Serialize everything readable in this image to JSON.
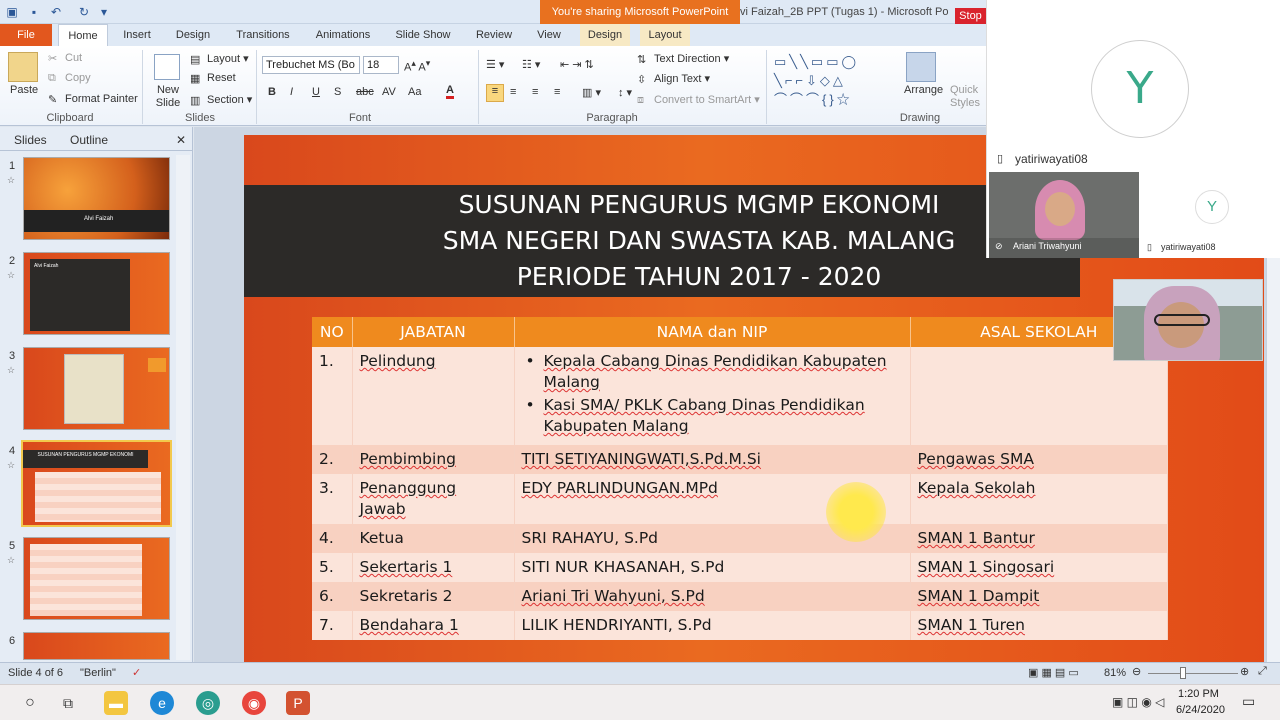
{
  "titlebar": {
    "share_banner": "You're sharing Microsoft PowerPoint",
    "window_title": "vi Faizah_2B PPT (Tugas 1) - Microsoft Po",
    "stop_label": "Stop"
  },
  "tabs": [
    "File",
    "Home",
    "Insert",
    "Design",
    "Transitions",
    "Animations",
    "Slide Show",
    "Review",
    "View",
    "Design",
    "Layout"
  ],
  "ribbon": {
    "clipboard": {
      "label": "Clipboard",
      "paste": "Paste",
      "cut": "Cut",
      "copy": "Copy",
      "format_painter": "Format Painter"
    },
    "slides": {
      "label": "Slides",
      "new_slide": "New Slide",
      "layout": "Layout",
      "reset": "Reset",
      "section": "Section"
    },
    "font": {
      "label": "Font",
      "family": "Trebuchet MS (Bo",
      "size": "18"
    },
    "paragraph": {
      "label": "Paragraph",
      "text_direction": "Text Direction",
      "align_text": "Align Text",
      "smartart": "Convert to SmartArt"
    },
    "drawing": {
      "label": "Drawing",
      "arrange": "Arrange",
      "quick_styles": "Quick Styles"
    }
  },
  "left_panel": {
    "tabs": [
      "Slides",
      "Outline"
    ],
    "thumbnails": [
      {
        "num": "1",
        "caption": "Alvi Faizah"
      },
      {
        "num": "2",
        "caption": "Alvi Faizah"
      },
      {
        "num": "3",
        "caption": ""
      },
      {
        "num": "4",
        "caption": "SUSUNAN PENGURUS MGMP EKONOMI"
      },
      {
        "num": "5",
        "caption": ""
      },
      {
        "num": "6",
        "caption": ""
      }
    ]
  },
  "slide": {
    "title_lines": [
      "SUSUNAN PENGURUS MGMP EKONOMI",
      "SMA NEGERI DAN SWASTA KAB. MALANG",
      "PERIODE TAHUN 2017 - 2020"
    ],
    "table": {
      "headers": [
        "NO",
        "JABATAN",
        "NAMA dan NIP",
        "ASAL SEKOLAH"
      ],
      "rows": [
        {
          "no": "1.",
          "jabatan": "Pelindung",
          "nama": "",
          "nama_list": [
            "Kepala Cabang Dinas Pendidikan Kabupaten Malang",
            "Kasi SMA/ PKLK Cabang Dinas Pendidikan Kabupaten Malang"
          ],
          "asal": ""
        },
        {
          "no": "2.",
          "jabatan": "Pembimbing",
          "nama": "TITI SETIYANINGWATI,S.Pd.M.Si",
          "asal": "Pengawas SMA"
        },
        {
          "no": "3.",
          "jabatan": "Penanggung Jawab",
          "nama": "EDY PARLINDUNGAN.MPd",
          "asal": "Kepala Sekolah"
        },
        {
          "no": "4.",
          "jabatan": "Ketua",
          "nama": "SRI RAHAYU, S.Pd",
          "asal": "SMAN 1 Bantur"
        },
        {
          "no": "5.",
          "jabatan": "Sekertaris 1",
          "nama": "SITI NUR KHASANAH, S.Pd",
          "asal": "SMAN 1 Singosari"
        },
        {
          "no": "6.",
          "jabatan": "Sekretaris 2",
          "nama": "Ariani Tri Wahyuni, S.Pd",
          "asal": "SMAN 1 Dampit"
        },
        {
          "no": "7.",
          "jabatan": "Bendahara 1",
          "nama": "LILIK HENDRIYANTI, S.Pd",
          "asal": "SMAN 1 Turen"
        }
      ]
    }
  },
  "statusbar": {
    "slide_info": "Slide 4 of 6",
    "theme": "\"Berlin\"",
    "zoom": "81%"
  },
  "video_panel": {
    "main_initial": "Y",
    "main_name": "yatiriwayati08",
    "tile1_name": "Ariani Triwahyuni",
    "tile2_initial": "Y",
    "tile2_name": "yatiriwayati08"
  },
  "taskbar": {
    "time": "1:20 PM",
    "date": "6/24/2020"
  },
  "colors": {
    "file_tab": "#e2571e",
    "slide_orange": "#e85d1e",
    "title_bar": "#2c2a28",
    "table_header": "#ef8a1e",
    "share_banner": "#e8711f",
    "stop": "#d9232d"
  }
}
